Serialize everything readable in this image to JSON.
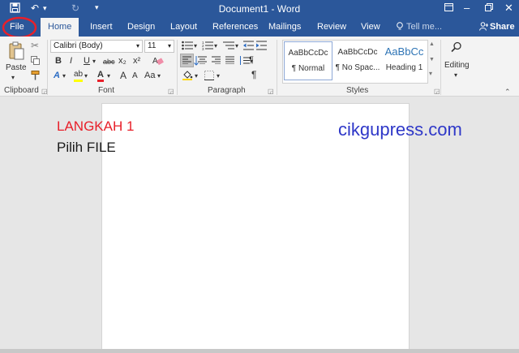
{
  "window": {
    "title": "Document1 - Word",
    "qat": {
      "save_icon": "save-icon",
      "undo_icon": "undo-icon",
      "redo_icon": "redo-icon",
      "customize_icon": "customize-icon"
    },
    "controls": {
      "ribbon_display": "ribbon-display-icon",
      "minimize": "minimize-icon",
      "restore": "restore-icon",
      "close": "close-icon"
    }
  },
  "tabs": {
    "file": "File",
    "home": "Home",
    "insert": "Insert",
    "design": "Design",
    "layout": "Layout",
    "references": "References",
    "mailings": "Mailings",
    "review": "Review",
    "view": "View",
    "tell_me": "Tell me...",
    "share": "Share"
  },
  "ribbon": {
    "clipboard": {
      "label": "Clipboard",
      "paste": "Paste"
    },
    "font": {
      "label": "Font",
      "font_name": "Calibri (Body)",
      "font_size": "11",
      "bold": "B",
      "italic": "I",
      "underline": "U",
      "strike": "abc",
      "subscript": "x₂",
      "superscript": "x²",
      "grow": "A",
      "shrink": "A",
      "case": "Aa",
      "highlight": "ab",
      "color": "A"
    },
    "paragraph": {
      "label": "Paragraph",
      "pilcrow": "¶"
    },
    "styles": {
      "label": "Styles",
      "items": [
        {
          "preview": "AaBbCcDc",
          "name": "¶ Normal"
        },
        {
          "preview": "AaBbCcDc",
          "name": "¶ No Spac..."
        },
        {
          "preview": "AaBbCc",
          "name": "Heading 1"
        }
      ]
    },
    "editing": {
      "label": "Editing"
    }
  },
  "annotations": {
    "step": "LANGKAH 1",
    "instruction": "Pilih FILE",
    "brand": "cikgupress.com",
    "accent": "#e8202a"
  },
  "colors": {
    "brand": "#2b579a",
    "ribbon": "#f3f3f3",
    "canvas": "#e6e6e6"
  }
}
